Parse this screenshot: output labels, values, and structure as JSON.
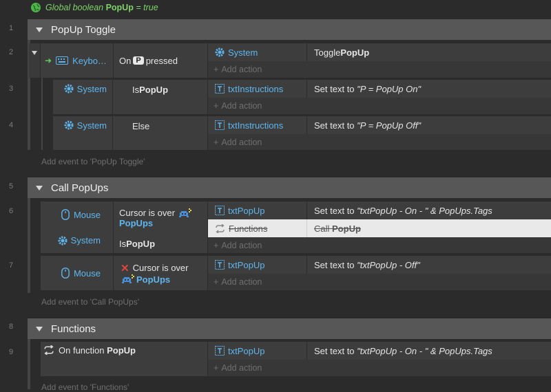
{
  "global_var": {
    "prefix": "Global boolean ",
    "name": "PopUp",
    "suffix": " = true"
  },
  "line_numbers": {
    "g1": "1",
    "e2": "2",
    "e3": "3",
    "e4": "4",
    "g5": "5",
    "e6": "6",
    "e7": "7",
    "g8": "8",
    "e9": "9"
  },
  "groups": {
    "popup_toggle": "PopUp Toggle",
    "call_popups": "Call PopUps",
    "functions": "Functions"
  },
  "add_action": "Add action",
  "add_event": {
    "popup_toggle": "Add event to 'PopUp Toggle'",
    "call_popups": "Add event to 'Call PopUps'",
    "functions": "Add event to 'Functions'"
  },
  "event2": {
    "object": "Keybo…",
    "cond_prefix": "On",
    "key": "P",
    "cond_suffix": "pressed",
    "action_object": "System",
    "action_prefix": "Toggle ",
    "action_bold": "PopUp"
  },
  "event3": {
    "object": "System",
    "cond_prefix": "Is ",
    "cond_bold": "PopUp",
    "action_object": "txtInstructions",
    "action_prefix": "Set text to ",
    "action_value": "\"P = PopUp On\""
  },
  "event4": {
    "object": "System",
    "cond": "Else",
    "action_object": "txtInstructions",
    "action_prefix": "Set text to ",
    "action_value": "\"P = PopUp Off\""
  },
  "event6": {
    "object1": "Mouse",
    "cond1_text": "Cursor is over",
    "cond1_link": "PopUps",
    "object2": "System",
    "cond2_prefix": "Is ",
    "cond2_bold": "PopUp",
    "action1_object": "txtPopUp",
    "action1_prefix": "Set text to ",
    "action1_value": "\"txtPopUp - On - \" & PopUps.Tags",
    "action2_object": "Functions",
    "action2_prefix": "Call ",
    "action2_bold": "PopUp"
  },
  "event7": {
    "object": "Mouse",
    "cond_text": "Cursor is over",
    "cond_link": "PopUps",
    "action_object": "txtPopUp",
    "action_prefix": "Set text to ",
    "action_value": "\"txtPopUp - Off\""
  },
  "event9": {
    "cond_prefix": "On function ",
    "cond_bold": "PopUp",
    "action_object": "txtPopUp",
    "action_prefix": "Set text to ",
    "action_value": "\"txtPopUp - On - \" & PopUps.Tags"
  },
  "colors": {
    "link": "#5fb6ef",
    "global": "#7fd36a",
    "group_bar": "#575757",
    "highlight": "#e9e9e9"
  }
}
